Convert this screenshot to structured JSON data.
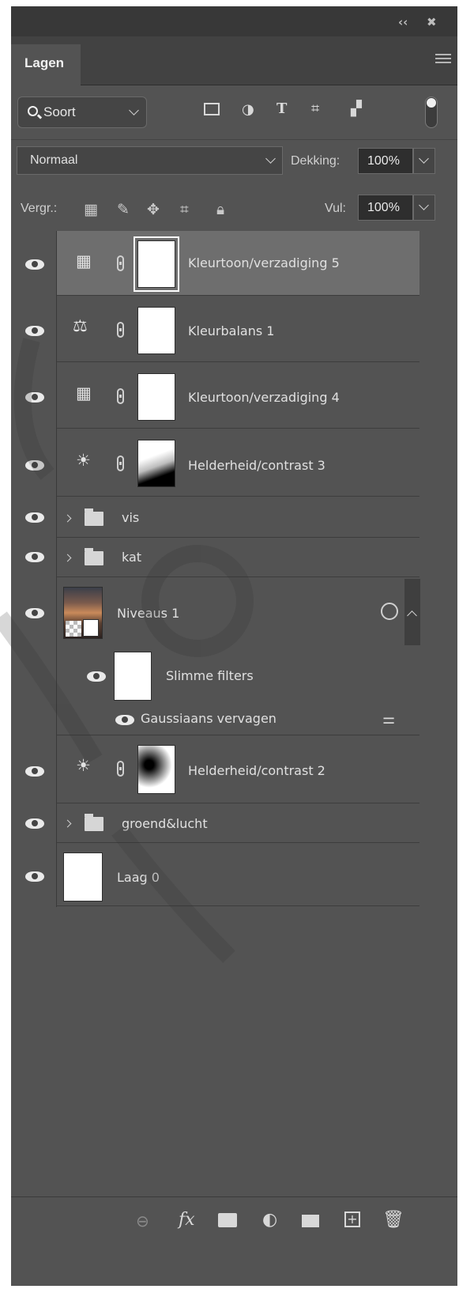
{
  "panel": {
    "title": "Lagen"
  },
  "filter": {
    "kind_label": "Soort"
  },
  "blend": {
    "mode": "Normaal",
    "opacity_label": "Dekking:",
    "opacity_value": "100%"
  },
  "lock": {
    "label": "Vergr.:",
    "fill_label": "Vul:",
    "fill_value": "100%"
  },
  "layers": [
    {
      "name": "Kleurtoon/verzadiging 5",
      "type": "hue-saturation",
      "visible": true,
      "selected": true
    },
    {
      "name": "Kleurbalans 1",
      "type": "color-balance",
      "visible": true
    },
    {
      "name": "Kleurtoon/verzadiging 4",
      "type": "hue-saturation",
      "visible": true
    },
    {
      "name": "Helderheid/contrast 3",
      "type": "brightness-contrast",
      "visible": true
    },
    {
      "name": "vis",
      "type": "group",
      "visible": true
    },
    {
      "name": "kat",
      "type": "group",
      "visible": true
    },
    {
      "name": "Niveaus 1",
      "type": "smart-object",
      "visible": true
    },
    {
      "name": "Slimme filters",
      "type": "smart-filters",
      "visible": true
    },
    {
      "name": "Gaussiaans vervagen",
      "type": "filter",
      "visible": true
    },
    {
      "name": "Helderheid/contrast 2",
      "type": "brightness-contrast",
      "visible": true
    },
    {
      "name": "groend&lucht",
      "type": "group",
      "visible": true
    },
    {
      "name": "Laag 0",
      "type": "pixel",
      "visible": true
    }
  ],
  "colors": {
    "panel_bg": "#535353",
    "selected_row": "#6e6e6e",
    "dark_bar": "#383838"
  }
}
